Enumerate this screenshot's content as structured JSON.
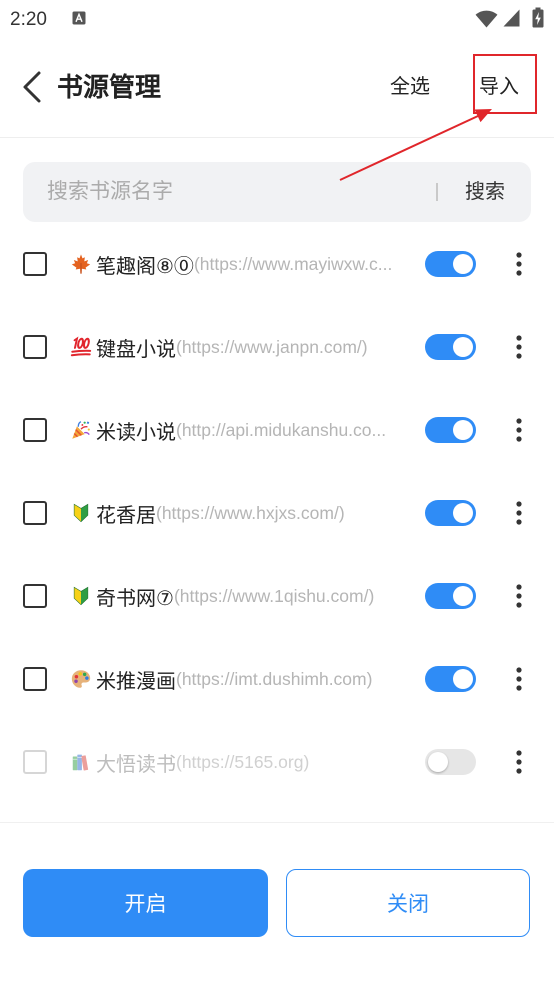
{
  "status_bar": {
    "time": "2:20",
    "notification_icon": "notification-a-icon",
    "system_icons": [
      "wifi-icon",
      "signal-icon",
      "battery-charging-icon"
    ]
  },
  "header": {
    "back_icon": "back-arrow-icon",
    "title": "书源管理",
    "select_all_label": "全选",
    "import_label": "导入"
  },
  "search": {
    "placeholder": "搜索书源名字",
    "button_label": "搜索"
  },
  "sources": [
    {
      "icon": "maple-leaf-icon",
      "name": "笔趣阁⑧⓪",
      "url": "(https://www.mayiwxw.c...",
      "checked": false,
      "enabled": true
    },
    {
      "icon": "hundred-points-icon",
      "name": "键盘小说",
      "url": "(https://www.janpn.com/)",
      "checked": false,
      "enabled": true
    },
    {
      "icon": "party-popper-icon",
      "name": "米读小说",
      "url": "(http://api.midukanshu.co...",
      "checked": false,
      "enabled": true
    },
    {
      "icon": "beginner-symbol-icon",
      "name": "花香居",
      "url": "(https://www.hxjxs.com/)",
      "checked": false,
      "enabled": true
    },
    {
      "icon": "beginner-symbol-icon",
      "name": "奇书网⑦",
      "url": "(https://www.1qishu.com/)",
      "checked": false,
      "enabled": true
    },
    {
      "icon": "palette-icon",
      "name": "米推漫画",
      "url": "(https://imt.dushimh.com)",
      "checked": false,
      "enabled": true
    },
    {
      "icon": "books-icon",
      "name": "大悟读书",
      "url": "(https://5165.org)",
      "checked": false,
      "enabled": false
    }
  ],
  "footer": {
    "enable_label": "开启",
    "disable_label": "关闭"
  },
  "colors": {
    "accent": "#2f8cf6",
    "annotation": "#e0262b",
    "toggle_off": "#e6e6e6",
    "text_primary": "#222222",
    "text_secondary": "#b5b5b5"
  }
}
